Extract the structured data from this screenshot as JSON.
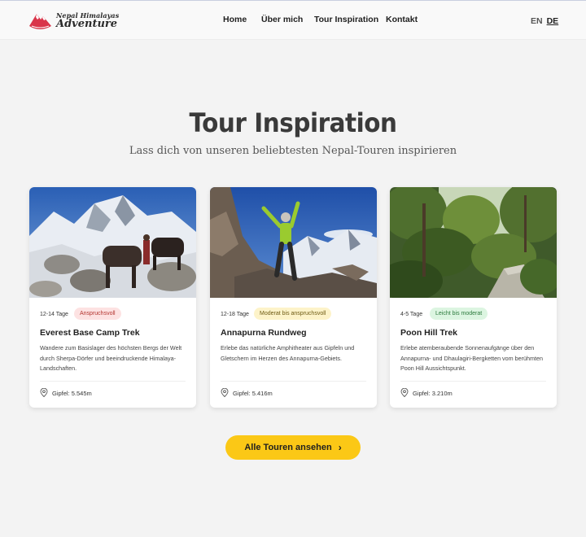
{
  "brand": {
    "line1": "Nepal Himalayas",
    "line2": "Adventure"
  },
  "nav": {
    "items": [
      "Home",
      "Über mich",
      "Tour Inspiration",
      "Kontakt"
    ]
  },
  "lang": {
    "en": "EN",
    "de": "DE",
    "active": "DE"
  },
  "page": {
    "title": "Tour Inspiration",
    "subtitle": "Lass dich von unseren beliebtesten Nepal-Touren inspirieren"
  },
  "tours": [
    {
      "days": "12-14 Tage",
      "difficulty": "Anspruchsvoll",
      "title": "Everest Base Camp Trek",
      "description": "Wandere zum Basislager des höchsten Bergs der Welt durch Sherpa-Dörfer und beeindruckende Himalaya-Landschaften.",
      "peak": "Gipfel: 5.545m"
    },
    {
      "days": "12-18 Tage",
      "difficulty": "Moderat bis anspruchsvoll",
      "title": "Annapurna Rundweg",
      "description": "Erlebe das natürliche Amphitheater aus Gipfeln und Gletschern im Herzen des Annapurna-Gebiets.",
      "peak": "Gipfel: 5.416m"
    },
    {
      "days": "4-5 Tage",
      "difficulty": "Leicht bis moderat",
      "title": "Poon Hill Trek",
      "description": "Erlebe atemberaubende Sonnenaufgänge über den Annapurna- und Dhaulagiri-Bergketten vom berühmten Poon Hill Aussichtspunkt.",
      "peak": "Gipfel: 3.210m"
    }
  ],
  "cta": {
    "label": "Alle Touren ansehen"
  },
  "colors": {
    "accent": "#fbc816",
    "logo": "#d9354a",
    "background": "#f3f3f3"
  }
}
